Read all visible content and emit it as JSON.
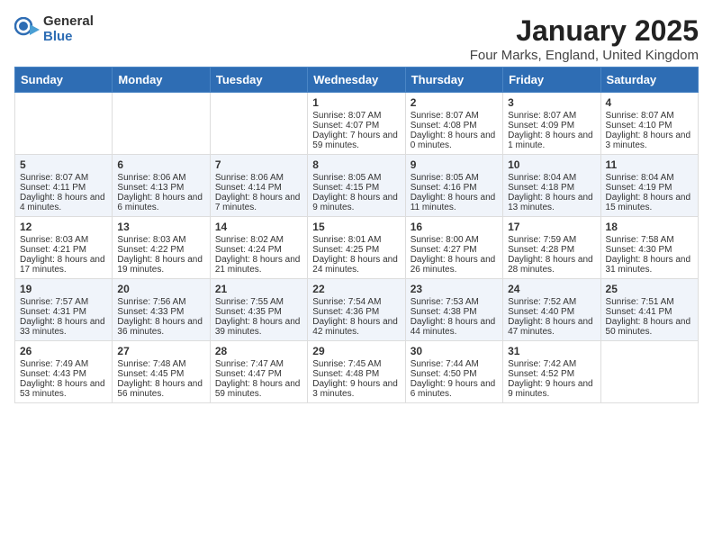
{
  "logo": {
    "general": "General",
    "blue": "Blue"
  },
  "title": "January 2025",
  "subtitle": "Four Marks, England, United Kingdom",
  "days": [
    "Sunday",
    "Monday",
    "Tuesday",
    "Wednesday",
    "Thursday",
    "Friday",
    "Saturday"
  ],
  "weeks": [
    [
      {
        "day": "",
        "content": ""
      },
      {
        "day": "",
        "content": ""
      },
      {
        "day": "",
        "content": ""
      },
      {
        "day": "1",
        "content": "Sunrise: 8:07 AM\nSunset: 4:07 PM\nDaylight: 7 hours and 59 minutes."
      },
      {
        "day": "2",
        "content": "Sunrise: 8:07 AM\nSunset: 4:08 PM\nDaylight: 8 hours and 0 minutes."
      },
      {
        "day": "3",
        "content": "Sunrise: 8:07 AM\nSunset: 4:09 PM\nDaylight: 8 hours and 1 minute."
      },
      {
        "day": "4",
        "content": "Sunrise: 8:07 AM\nSunset: 4:10 PM\nDaylight: 8 hours and 3 minutes."
      }
    ],
    [
      {
        "day": "5",
        "content": "Sunrise: 8:07 AM\nSunset: 4:11 PM\nDaylight: 8 hours and 4 minutes."
      },
      {
        "day": "6",
        "content": "Sunrise: 8:06 AM\nSunset: 4:13 PM\nDaylight: 8 hours and 6 minutes."
      },
      {
        "day": "7",
        "content": "Sunrise: 8:06 AM\nSunset: 4:14 PM\nDaylight: 8 hours and 7 minutes."
      },
      {
        "day": "8",
        "content": "Sunrise: 8:05 AM\nSunset: 4:15 PM\nDaylight: 8 hours and 9 minutes."
      },
      {
        "day": "9",
        "content": "Sunrise: 8:05 AM\nSunset: 4:16 PM\nDaylight: 8 hours and 11 minutes."
      },
      {
        "day": "10",
        "content": "Sunrise: 8:04 AM\nSunset: 4:18 PM\nDaylight: 8 hours and 13 minutes."
      },
      {
        "day": "11",
        "content": "Sunrise: 8:04 AM\nSunset: 4:19 PM\nDaylight: 8 hours and 15 minutes."
      }
    ],
    [
      {
        "day": "12",
        "content": "Sunrise: 8:03 AM\nSunset: 4:21 PM\nDaylight: 8 hours and 17 minutes."
      },
      {
        "day": "13",
        "content": "Sunrise: 8:03 AM\nSunset: 4:22 PM\nDaylight: 8 hours and 19 minutes."
      },
      {
        "day": "14",
        "content": "Sunrise: 8:02 AM\nSunset: 4:24 PM\nDaylight: 8 hours and 21 minutes."
      },
      {
        "day": "15",
        "content": "Sunrise: 8:01 AM\nSunset: 4:25 PM\nDaylight: 8 hours and 24 minutes."
      },
      {
        "day": "16",
        "content": "Sunrise: 8:00 AM\nSunset: 4:27 PM\nDaylight: 8 hours and 26 minutes."
      },
      {
        "day": "17",
        "content": "Sunrise: 7:59 AM\nSunset: 4:28 PM\nDaylight: 8 hours and 28 minutes."
      },
      {
        "day": "18",
        "content": "Sunrise: 7:58 AM\nSunset: 4:30 PM\nDaylight: 8 hours and 31 minutes."
      }
    ],
    [
      {
        "day": "19",
        "content": "Sunrise: 7:57 AM\nSunset: 4:31 PM\nDaylight: 8 hours and 33 minutes."
      },
      {
        "day": "20",
        "content": "Sunrise: 7:56 AM\nSunset: 4:33 PM\nDaylight: 8 hours and 36 minutes."
      },
      {
        "day": "21",
        "content": "Sunrise: 7:55 AM\nSunset: 4:35 PM\nDaylight: 8 hours and 39 minutes."
      },
      {
        "day": "22",
        "content": "Sunrise: 7:54 AM\nSunset: 4:36 PM\nDaylight: 8 hours and 42 minutes."
      },
      {
        "day": "23",
        "content": "Sunrise: 7:53 AM\nSunset: 4:38 PM\nDaylight: 8 hours and 44 minutes."
      },
      {
        "day": "24",
        "content": "Sunrise: 7:52 AM\nSunset: 4:40 PM\nDaylight: 8 hours and 47 minutes."
      },
      {
        "day": "25",
        "content": "Sunrise: 7:51 AM\nSunset: 4:41 PM\nDaylight: 8 hours and 50 minutes."
      }
    ],
    [
      {
        "day": "26",
        "content": "Sunrise: 7:49 AM\nSunset: 4:43 PM\nDaylight: 8 hours and 53 minutes."
      },
      {
        "day": "27",
        "content": "Sunrise: 7:48 AM\nSunset: 4:45 PM\nDaylight: 8 hours and 56 minutes."
      },
      {
        "day": "28",
        "content": "Sunrise: 7:47 AM\nSunset: 4:47 PM\nDaylight: 8 hours and 59 minutes."
      },
      {
        "day": "29",
        "content": "Sunrise: 7:45 AM\nSunset: 4:48 PM\nDaylight: 9 hours and 3 minutes."
      },
      {
        "day": "30",
        "content": "Sunrise: 7:44 AM\nSunset: 4:50 PM\nDaylight: 9 hours and 6 minutes."
      },
      {
        "day": "31",
        "content": "Sunrise: 7:42 AM\nSunset: 4:52 PM\nDaylight: 9 hours and 9 minutes."
      },
      {
        "day": "",
        "content": ""
      }
    ]
  ]
}
